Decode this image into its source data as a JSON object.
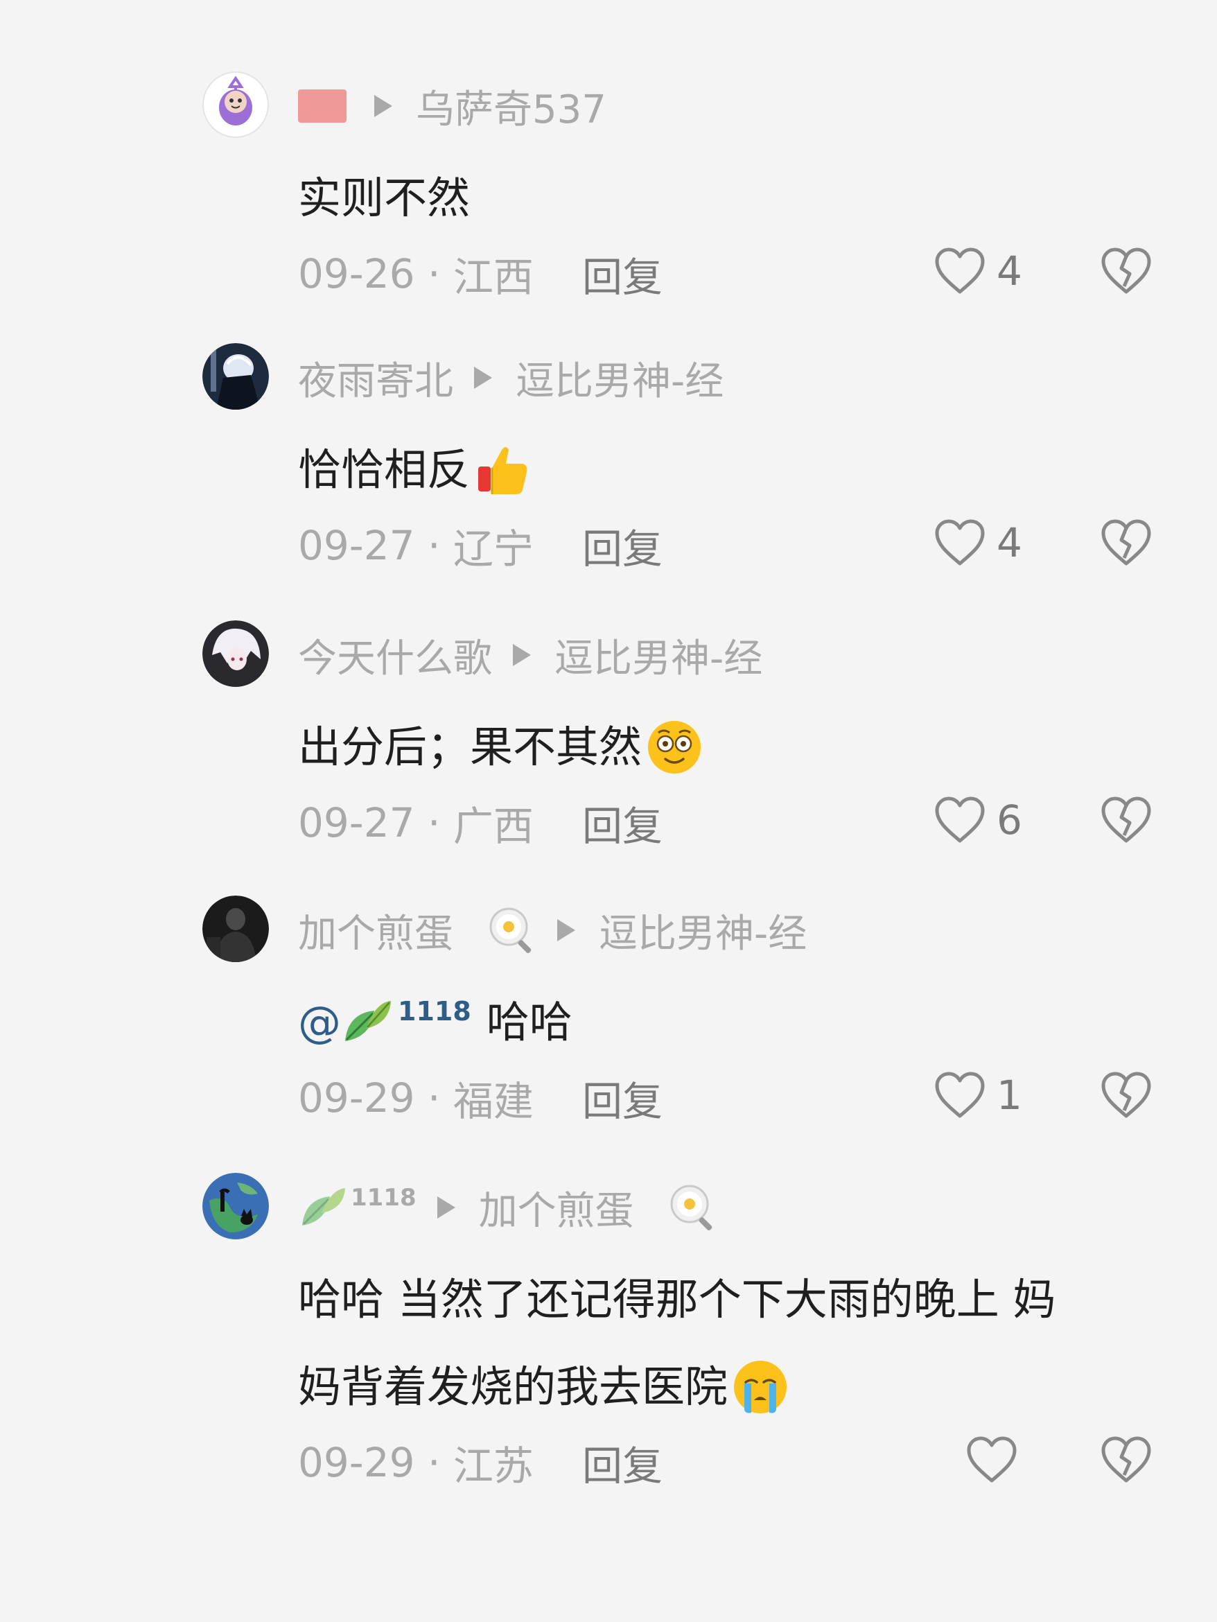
{
  "reply_label": "回复",
  "comments": [
    {
      "author": "",
      "has_flag": true,
      "reply_to": "乌萨奇537",
      "text": "实则不然",
      "date": "09-26",
      "location": "江西",
      "likes": "4",
      "avatar_icon": "purple-teletubby-avatar"
    },
    {
      "author": "夜雨寄北",
      "reply_to": "逗比男神-经",
      "text": "恰恰相反",
      "emoji": "thumbs-up-emoji",
      "date": "09-27",
      "location": "辽宁",
      "likes": "4",
      "avatar_icon": "dark-anime-avatar"
    },
    {
      "author": "今天什么歌",
      "reply_to": "逗比男神-经",
      "text": "出分后；果不其然",
      "emoji": "flushed-face-emoji",
      "date": "09-27",
      "location": "广西",
      "likes": "6",
      "avatar_icon": "white-hair-anime-avatar"
    },
    {
      "author": "加个煎蛋",
      "author_badge": "fried-egg-pan-icon",
      "reply_to": "逗比男神-经",
      "mention": {
        "at": "@",
        "number": "1118",
        "icon": "leaf-icon"
      },
      "text": "哈哈",
      "date": "09-29",
      "location": "福建",
      "likes": "1",
      "avatar_icon": "dark-figure-avatar"
    },
    {
      "author_number": "1118",
      "author_icon": "leaf-icon",
      "reply_to": "加个煎蛋",
      "reply_to_badge": "fried-egg-pan-icon",
      "text_line1": "哈哈 当然了还记得那个下大雨的晚上 妈",
      "text_line2": "妈背着发烧的我去医院",
      "emoji": "crying-face-emoji",
      "date": "09-29",
      "location": "江苏",
      "likes": "",
      "avatar_icon": "blue-earth-cat-avatar"
    }
  ],
  "colors": {
    "background": "#f4f4f4",
    "meta_text": "#a9a9a9",
    "body_text": "#1f1f1f",
    "mention": "#2f5d8a",
    "reply_link": "#7a7a7a"
  }
}
